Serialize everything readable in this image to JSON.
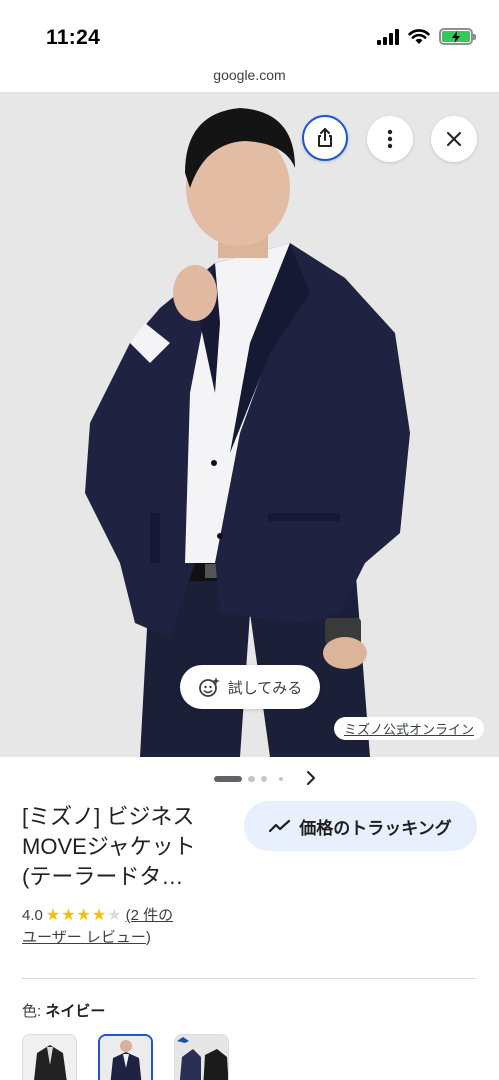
{
  "status_bar": {
    "time": "11:24"
  },
  "browser": {
    "url": "google.com"
  },
  "image_overlay": {
    "try_on_label": "試してみる",
    "source_label": "ミズノ公式オンライン"
  },
  "carousel": {
    "total_images": 4,
    "active_index": 0
  },
  "product": {
    "title_lines": [
      "[ミズノ] ビジネス",
      "MOVEジャケット",
      "(テーラードタ…"
    ],
    "rating_value": "4.0",
    "rating_stars": 4,
    "max_stars": 5,
    "reviews_line1": "(2 件の",
    "reviews_line2": "ユーザー レビュー",
    "reviews_close": ")",
    "price_tracking_label": "価格のトラッキング",
    "color_label": "色:",
    "color_value": "ネイビー"
  },
  "colors": {
    "accent_blue": "#1a56d6",
    "star": "#fbbc04",
    "tracking_bg": "#e8f0fe",
    "battery_green": "#34c759",
    "suit_navy": "#1f2240"
  },
  "icons": [
    "share-icon",
    "more-vert-icon",
    "close-icon",
    "try-on-sparkle-icon",
    "chevron-right-icon",
    "trending-up-icon",
    "wifi-icon",
    "battery-charging-icon",
    "signal-icon"
  ]
}
